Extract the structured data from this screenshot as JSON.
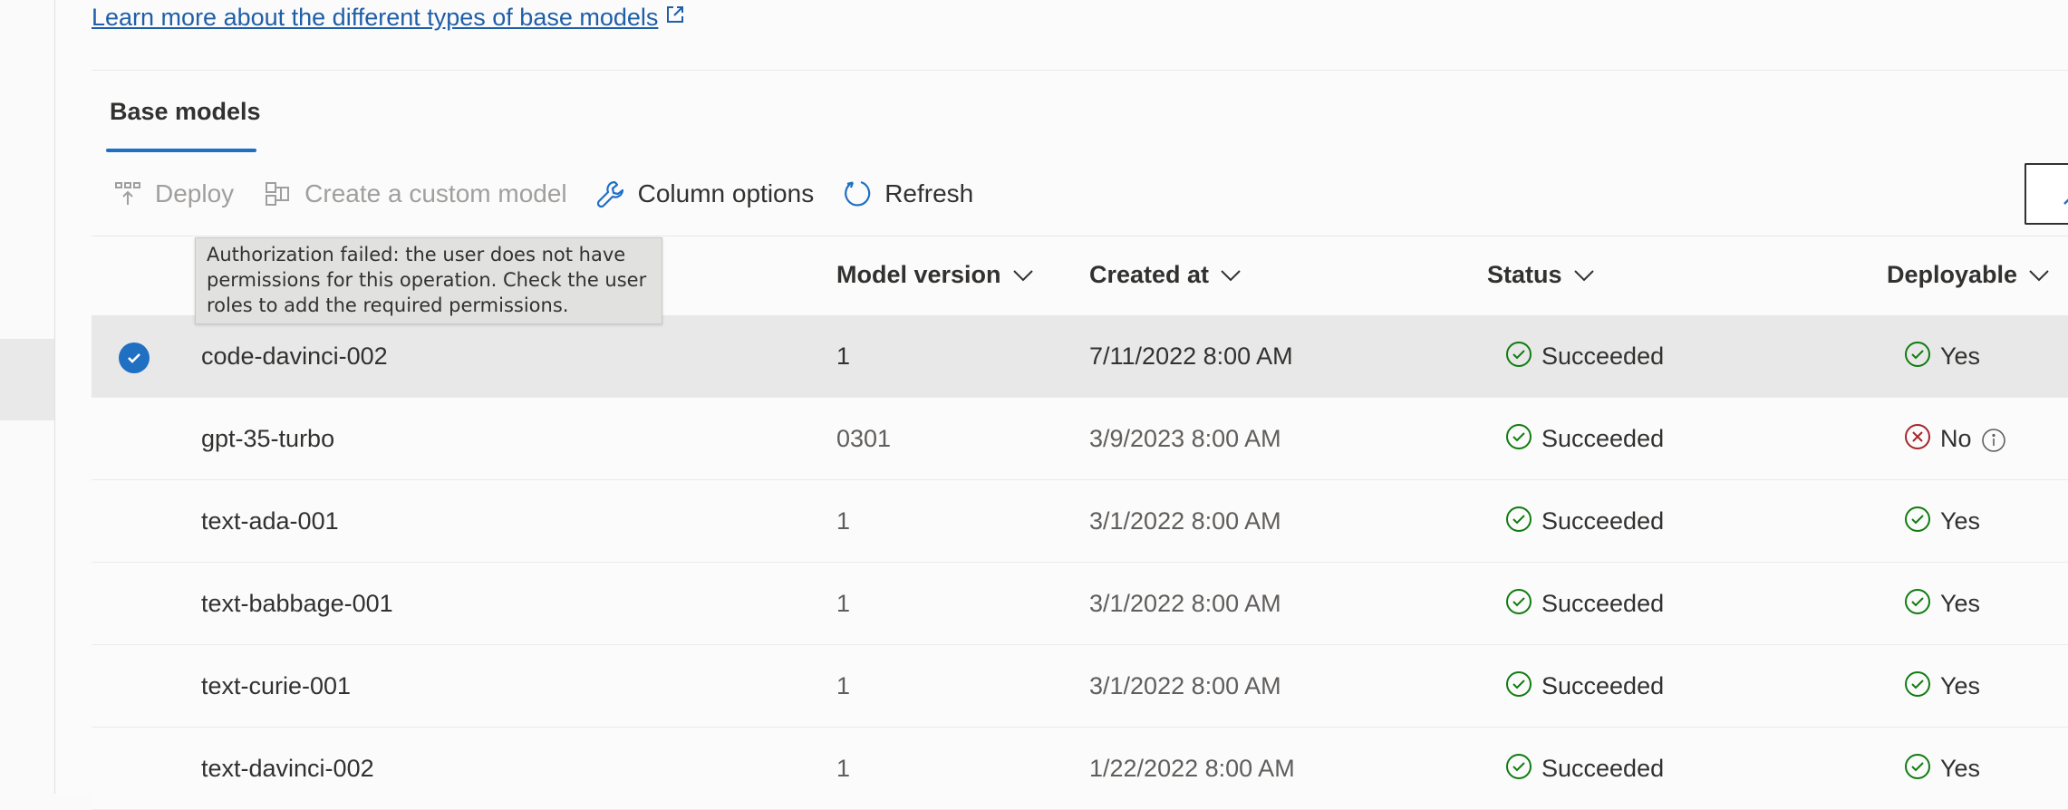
{
  "link": {
    "learn_more": "Learn more about the different types of base models"
  },
  "tabs": [
    {
      "label": "Base models"
    }
  ],
  "toolbar": {
    "deploy": "Deploy",
    "create_custom": "Create a custom model",
    "column_options": "Column options",
    "refresh": "Refresh"
  },
  "tooltip": {
    "text": "Authorization failed: the user does not have permissions for this operation. Check the user roles to add the required permissions."
  },
  "table": {
    "columns": {
      "model_version": "Model version",
      "created_at": "Created at",
      "status": "Status",
      "deployable": "Deployable"
    },
    "rows": [
      {
        "name": "code-davinci-002",
        "version": "1",
        "created": "7/11/2022 8:00 AM",
        "status": "Succeeded",
        "deployable": "Yes",
        "selected": true
      },
      {
        "name": "gpt-35-turbo",
        "version": "0301",
        "created": "3/9/2023 8:00 AM",
        "status": "Succeeded",
        "deployable": "No",
        "selected": false
      },
      {
        "name": "text-ada-001",
        "version": "1",
        "created": "3/1/2022 8:00 AM",
        "status": "Succeeded",
        "deployable": "Yes",
        "selected": false
      },
      {
        "name": "text-babbage-001",
        "version": "1",
        "created": "3/1/2022 8:00 AM",
        "status": "Succeeded",
        "deployable": "Yes",
        "selected": false
      },
      {
        "name": "text-curie-001",
        "version": "1",
        "created": "3/1/2022 8:00 AM",
        "status": "Succeeded",
        "deployable": "Yes",
        "selected": false
      },
      {
        "name": "text-davinci-002",
        "version": "1",
        "created": "1/22/2022 8:00 AM",
        "status": "Succeeded",
        "deployable": "Yes",
        "selected": false
      }
    ]
  },
  "colors": {
    "accent": "#1f6fc3",
    "link": "#1f5fa8",
    "success": "#107c10",
    "error": "#a4262c"
  }
}
